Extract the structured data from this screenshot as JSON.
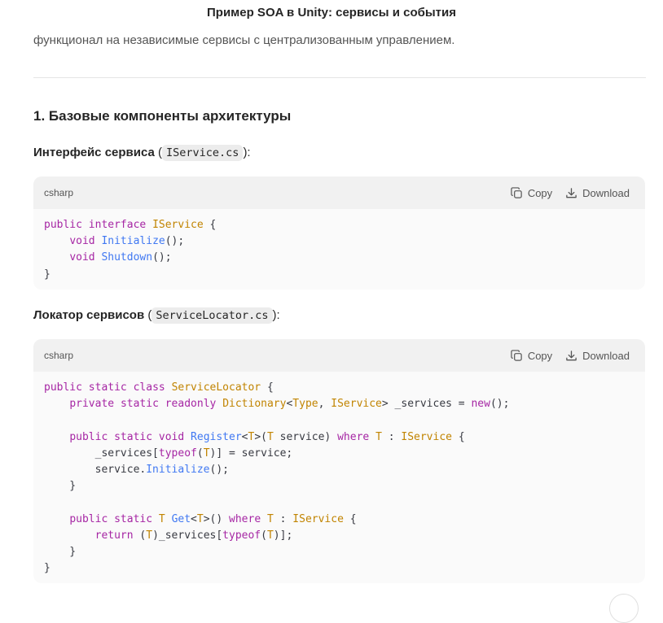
{
  "header": {
    "title": "Пример SOA в Unity: сервисы и события"
  },
  "intro_tail": "функционал на независимые сервисы с централизованным управлением.",
  "section": {
    "heading": "1. Базовые компоненты архитектуры"
  },
  "items": [
    {
      "label": "Интерфейс сервиса",
      "open": " (",
      "file": "IService.cs",
      "close": "):",
      "code": {
        "lang": "csharp",
        "copy_label": "Copy",
        "download_label": "Download",
        "lines": [
          [
            [
              "kw",
              "public"
            ],
            [
              "pl",
              " "
            ],
            [
              "kw",
              "interface"
            ],
            [
              "pl",
              " "
            ],
            [
              "ty",
              "IService"
            ],
            [
              "pl",
              " {"
            ]
          ],
          [
            [
              "pl",
              "    "
            ],
            [
              "kw",
              "void"
            ],
            [
              "pl",
              " "
            ],
            [
              "fn",
              "Initialize"
            ],
            [
              "pl",
              "();"
            ]
          ],
          [
            [
              "pl",
              "    "
            ],
            [
              "kw",
              "void"
            ],
            [
              "pl",
              " "
            ],
            [
              "fn",
              "Shutdown"
            ],
            [
              "pl",
              "();"
            ]
          ],
          [
            [
              "pl",
              "}"
            ]
          ]
        ]
      }
    },
    {
      "label": "Локатор сервисов",
      "open": " (",
      "file": "ServiceLocator.cs",
      "close": "):",
      "code": {
        "lang": "csharp",
        "copy_label": "Copy",
        "download_label": "Download",
        "lines": [
          [
            [
              "kw",
              "public"
            ],
            [
              "pl",
              " "
            ],
            [
              "kw",
              "static"
            ],
            [
              "pl",
              " "
            ],
            [
              "kw",
              "class"
            ],
            [
              "pl",
              " "
            ],
            [
              "ty",
              "ServiceLocator"
            ],
            [
              "pl",
              " {"
            ]
          ],
          [
            [
              "pl",
              "    "
            ],
            [
              "kw",
              "private"
            ],
            [
              "pl",
              " "
            ],
            [
              "kw",
              "static"
            ],
            [
              "pl",
              " "
            ],
            [
              "kw",
              "readonly"
            ],
            [
              "pl",
              " "
            ],
            [
              "ty",
              "Dictionary"
            ],
            [
              "pl",
              "<"
            ],
            [
              "ty",
              "Type"
            ],
            [
              "pl",
              ", "
            ],
            [
              "ty",
              "IService"
            ],
            [
              "pl",
              "> _services = "
            ],
            [
              "kw",
              "new"
            ],
            [
              "pl",
              "();"
            ]
          ],
          [
            [
              "pl",
              ""
            ]
          ],
          [
            [
              "pl",
              "    "
            ],
            [
              "kw",
              "public"
            ],
            [
              "pl",
              " "
            ],
            [
              "kw",
              "static"
            ],
            [
              "pl",
              " "
            ],
            [
              "kw",
              "void"
            ],
            [
              "pl",
              " "
            ],
            [
              "fn",
              "Register"
            ],
            [
              "pl",
              "<"
            ],
            [
              "ty",
              "T"
            ],
            [
              "pl",
              ">("
            ],
            [
              "ty",
              "T"
            ],
            [
              "pl",
              " service) "
            ],
            [
              "kw",
              "where"
            ],
            [
              "pl",
              " "
            ],
            [
              "ty",
              "T"
            ],
            [
              "pl",
              " : "
            ],
            [
              "ty",
              "IService"
            ],
            [
              "pl",
              " {"
            ]
          ],
          [
            [
              "pl",
              "        _services["
            ],
            [
              "kw",
              "typeof"
            ],
            [
              "pl",
              "("
            ],
            [
              "ty",
              "T"
            ],
            [
              "pl",
              ")] = service;"
            ]
          ],
          [
            [
              "pl",
              "        service."
            ],
            [
              "fn",
              "Initialize"
            ],
            [
              "pl",
              "();"
            ]
          ],
          [
            [
              "pl",
              "    }"
            ]
          ],
          [
            [
              "pl",
              ""
            ]
          ],
          [
            [
              "pl",
              "    "
            ],
            [
              "kw",
              "public"
            ],
            [
              "pl",
              " "
            ],
            [
              "kw",
              "static"
            ],
            [
              "pl",
              " "
            ],
            [
              "ty",
              "T"
            ],
            [
              "pl",
              " "
            ],
            [
              "fn",
              "Get"
            ],
            [
              "pl",
              "<"
            ],
            [
              "ty",
              "T"
            ],
            [
              "pl",
              ">() "
            ],
            [
              "kw",
              "where"
            ],
            [
              "pl",
              " "
            ],
            [
              "ty",
              "T"
            ],
            [
              "pl",
              " : "
            ],
            [
              "ty",
              "IService"
            ],
            [
              "pl",
              " {"
            ]
          ],
          [
            [
              "pl",
              "        "
            ],
            [
              "kw",
              "return"
            ],
            [
              "pl",
              " ("
            ],
            [
              "ty",
              "T"
            ],
            [
              "pl",
              ")_services["
            ],
            [
              "kw",
              "typeof"
            ],
            [
              "pl",
              "("
            ],
            [
              "ty",
              "T"
            ],
            [
              "pl",
              ")];"
            ]
          ],
          [
            [
              "pl",
              "    }"
            ]
          ],
          [
            [
              "pl",
              "}"
            ]
          ]
        ]
      }
    }
  ],
  "icons": {
    "copy": "copy-icon",
    "download": "download-icon"
  },
  "colors": {
    "keyword": "#a626a4",
    "type": "#c18401",
    "function": "#4078f2",
    "plain": "#383a42"
  }
}
